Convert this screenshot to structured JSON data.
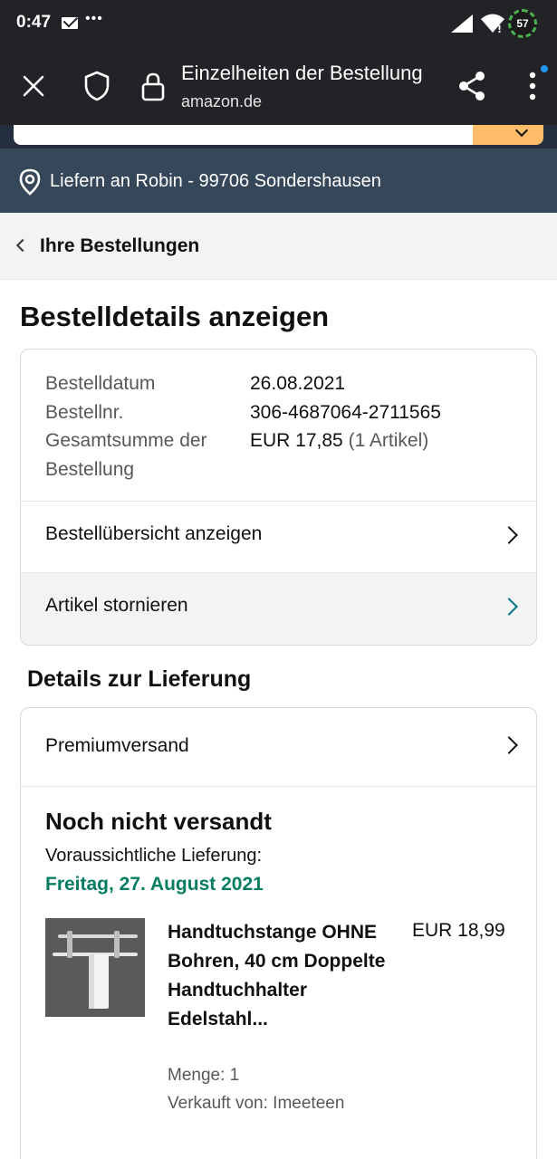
{
  "status_bar": {
    "time": "0:47",
    "dots": "•••",
    "battery": "57"
  },
  "browser": {
    "title": "Einzelheiten der Bestellung",
    "url": "amazon.de"
  },
  "header": {
    "deliver_to": "Liefern an Robin - 99706 Sondershausen"
  },
  "breadcrumb": {
    "label": "Ihre Bestellungen"
  },
  "page": {
    "title": "Bestelldetails anzeigen"
  },
  "order": {
    "date_label": "Bestelldatum",
    "date_value": "26.08.2021",
    "number_label": "Bestellnr.",
    "number_value": "306-4687064-2711565",
    "total_label_1": "Gesamtsumme der",
    "total_label_2": "Bestellung",
    "total_value": "EUR 17,85",
    "total_items": "(1 Artikel)",
    "summary_link": "Bestellübersicht anzeigen",
    "cancel_link": "Artikel stornieren"
  },
  "delivery": {
    "section_title": "Details zur Lieferung",
    "shipping_method": "Premiumversand",
    "status": "Noch nicht versandt",
    "expected_label": "Voraussichtliche Lieferung:",
    "expected_date": "Freitag, 27. August 2021",
    "item": {
      "title": "Handtuchstange OHNE Bohren, 40 cm Doppelte Handtuchhalter Edelstahl...",
      "price": "EUR 18,99",
      "quantity": "Menge: 1",
      "seller": "Verkauft von: Imeeteen"
    }
  },
  "colors": {
    "status_bar": "#222326",
    "amazon_header": "#232f3e",
    "delivery_bar": "#37475a",
    "search_button": "#febd69",
    "delivery_date": "#067d62",
    "link_teal": "#007185"
  }
}
